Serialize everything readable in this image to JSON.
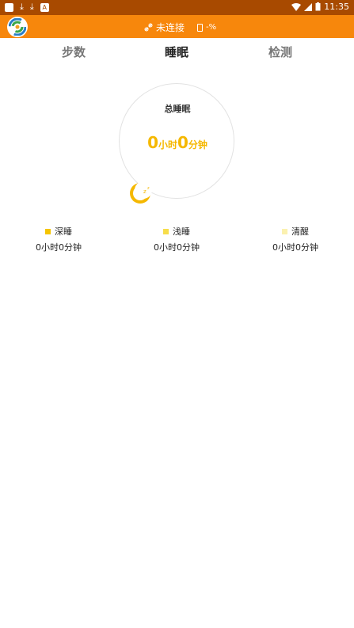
{
  "status_bar": {
    "time": "11:35",
    "icons": [
      "notification-square-icon",
      "download-icon",
      "download-icon",
      "a-box-icon",
      "wifi-icon",
      "signal-icon",
      "battery-icon"
    ],
    "colors": {
      "background": "#a84a00"
    }
  },
  "app_bar": {
    "connection_text": "未连接",
    "battery_text": "-%",
    "colors": {
      "background": "#f7870c"
    }
  },
  "tabs": [
    {
      "label": "步数",
      "active": false
    },
    {
      "label": "睡眠",
      "active": true
    },
    {
      "label": "检测",
      "active": false
    }
  ],
  "sleep_summary": {
    "title": "总睡眠",
    "hours": "0",
    "hours_unit": "小时",
    "minutes": "0",
    "minutes_unit": "分钟",
    "accent_color": "#f5b800"
  },
  "legend": [
    {
      "label": "深睡",
      "value": "0小时0分钟",
      "color": "#f5c400"
    },
    {
      "label": "浅睡",
      "value": "0小时0分钟",
      "color": "#f7dd4a"
    },
    {
      "label": "清醒",
      "value": "0小时0分钟",
      "color": "#fbf1b0"
    }
  ]
}
